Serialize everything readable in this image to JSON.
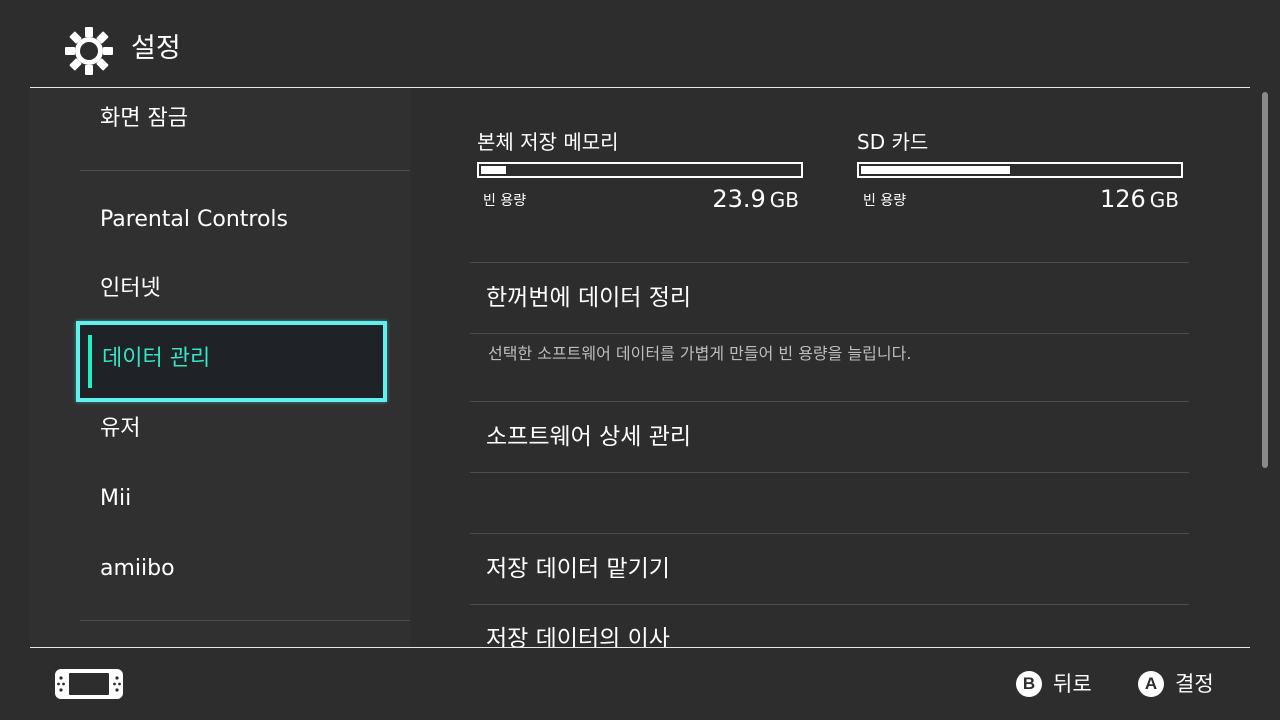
{
  "header": {
    "title": "설정",
    "icon": "gear-icon"
  },
  "sidebar": {
    "items": [
      {
        "label": "화면 잠금"
      },
      {
        "label": "Parental Controls"
      },
      {
        "label": "인터넷"
      },
      {
        "label": "데이터 관리",
        "selected": true
      },
      {
        "label": "유저"
      },
      {
        "label": "Mii"
      },
      {
        "label": "amiibo"
      }
    ]
  },
  "storage": {
    "internal": {
      "name": "본체 저장 메모리",
      "free_label": "빈 용량",
      "free_value": "23.9",
      "free_unit": "GB",
      "used_fraction": 0.08
    },
    "sd": {
      "name": "SD 카드",
      "free_label": "빈 용량",
      "free_value": "126",
      "free_unit": "GB",
      "used_fraction": 0.47
    }
  },
  "menu": {
    "cleanup": {
      "label": "한꺼번에 데이터 정리",
      "description": "선택한 소프트웨어 데이터를 가볍게 만들어 빈 용량을 늘립니다."
    },
    "software_detail": {
      "label": "소프트웨어 상세 관리"
    },
    "save_data_backup": {
      "label": "저장 데이터 맡기기"
    },
    "save_data_transfer": {
      "label": "저장 데이터의 이사"
    }
  },
  "footer": {
    "console_icon": "switch-console-icon",
    "back": {
      "button": "B",
      "label": "뒤로"
    },
    "confirm": {
      "button": "A",
      "label": "결정"
    }
  },
  "colors": {
    "background": "#2d2d2d",
    "sidebar": "#303030",
    "selection_border": "#5ff0f0",
    "selection_text": "#34e6c4",
    "accent_bar": "#20f0c8"
  }
}
